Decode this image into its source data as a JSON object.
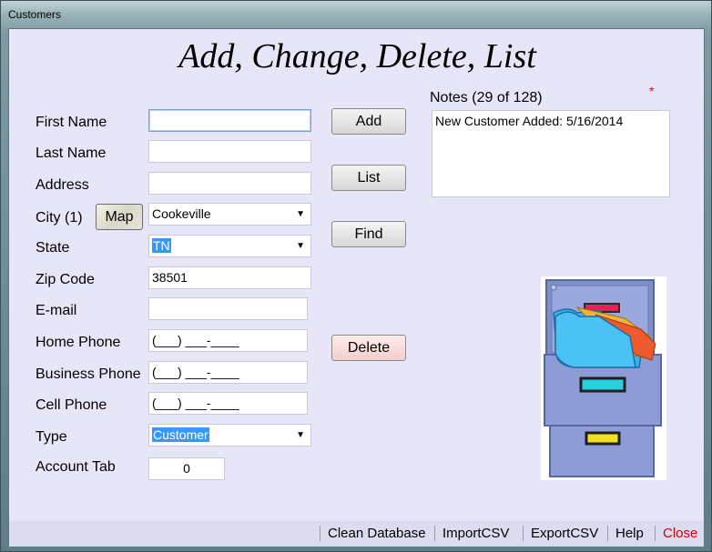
{
  "window": {
    "title": "Customers"
  },
  "heading": "Add, Change, Delete, List",
  "fields": {
    "first_name": {
      "label": "First Name",
      "value": ""
    },
    "last_name": {
      "label": "Last Name",
      "value": ""
    },
    "address": {
      "label": "Address",
      "value": ""
    },
    "city": {
      "label": "City (1)",
      "value": "Cookeville",
      "map_label": "Map"
    },
    "state": {
      "label": "State",
      "value": "TN"
    },
    "zip": {
      "label": "Zip Code",
      "value": "38501"
    },
    "email": {
      "label": "E-mail",
      "value": ""
    },
    "home_phone": {
      "label": "Home Phone",
      "value": "(___) ___-____"
    },
    "business_phone": {
      "label": "Business Phone",
      "value": "(___) ___-____"
    },
    "cell_phone": {
      "label": "Cell Phone",
      "value": "(___) ___-____"
    },
    "type": {
      "label": "Type",
      "value": "Customer"
    },
    "account_tab": {
      "label": "Account Tab",
      "value": "0"
    }
  },
  "buttons": {
    "add": "Add",
    "list": "List",
    "find": "Find",
    "delete": "Delete"
  },
  "notes": {
    "label": "Notes (29 of 128)",
    "value": "New Customer Added: 5/16/2014",
    "required_mark": "*"
  },
  "bottom_menu": {
    "clean_database": "Clean Database",
    "import_csv": "ImportCSV",
    "export_csv": "ExportCSV",
    "help": "Help",
    "close": "Close"
  },
  "icons": {
    "cabinet": "file-cabinet-icon",
    "dropdown": "chevron-down-icon",
    "map": "map-icon"
  },
  "colors": {
    "selection": "#3399ff",
    "close_text": "#d40000",
    "asterisk": "#ee0000",
    "client_bg": "#e6e6f8"
  }
}
